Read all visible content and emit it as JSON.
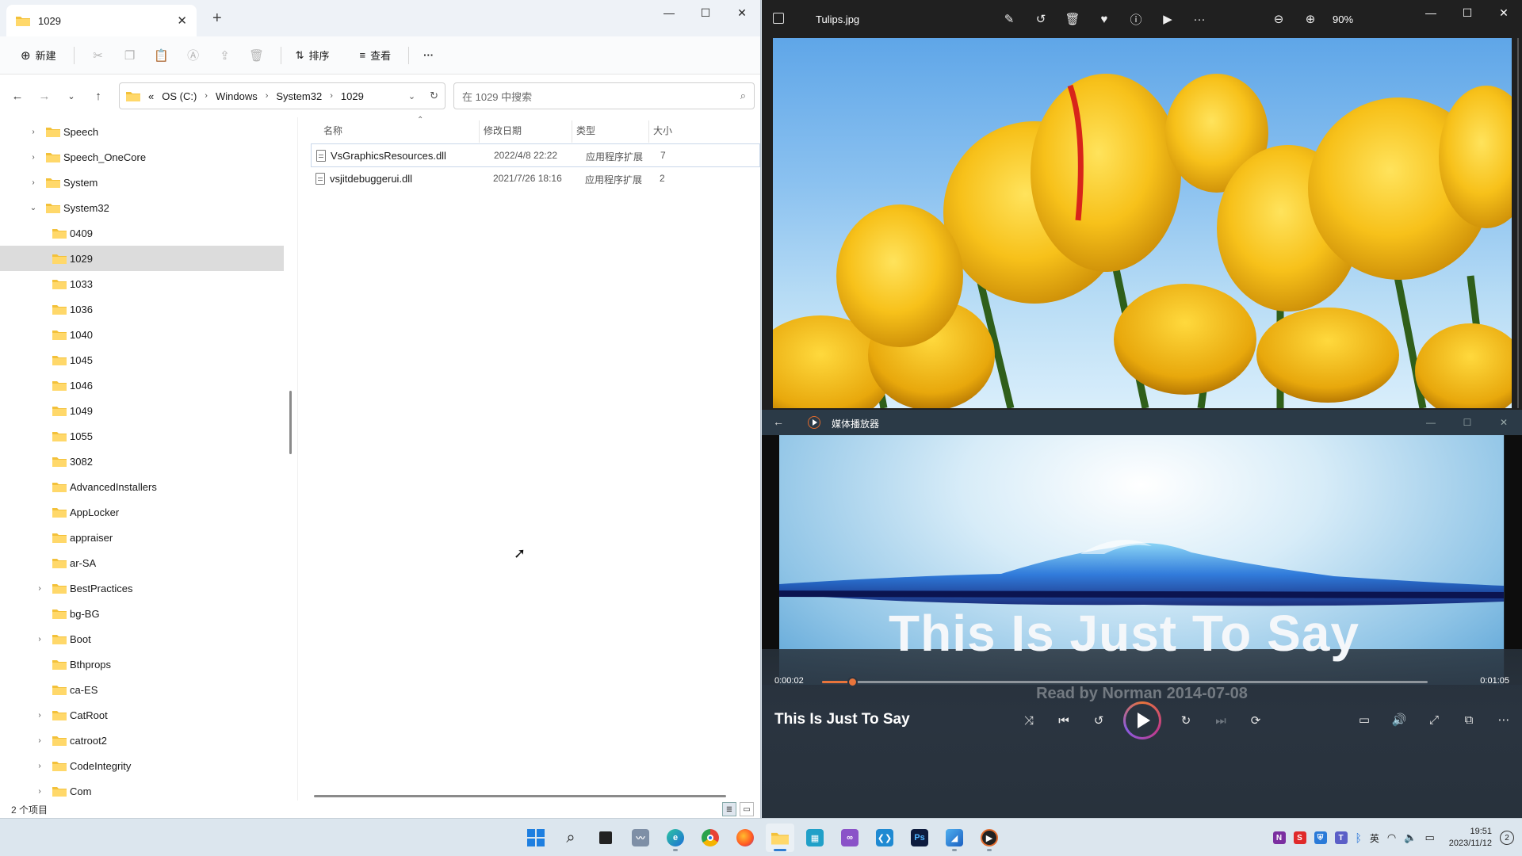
{
  "explorer": {
    "tab_title": "1029",
    "toolbar": {
      "new_label": "新建",
      "sort_label": "排序",
      "view_label": "查看",
      "more_label": "···"
    },
    "address": {
      "overflow": "«",
      "crumbs": [
        "OS (C:)",
        "Windows",
        "System32",
        "1029"
      ]
    },
    "search_placeholder": "在 1029 中搜索",
    "tree": [
      {
        "label": "Speech",
        "level": 0,
        "expand": "collapsed"
      },
      {
        "label": "Speech_OneCore",
        "level": 0,
        "expand": "collapsed"
      },
      {
        "label": "System",
        "level": 0,
        "expand": "collapsed"
      },
      {
        "label": "System32",
        "level": 0,
        "expand": "expanded"
      },
      {
        "label": "0409",
        "level": 1,
        "expand": "none"
      },
      {
        "label": "1029",
        "level": 1,
        "expand": "none",
        "selected": true
      },
      {
        "label": "1033",
        "level": 1,
        "expand": "none"
      },
      {
        "label": "1036",
        "level": 1,
        "expand": "none"
      },
      {
        "label": "1040",
        "level": 1,
        "expand": "none"
      },
      {
        "label": "1045",
        "level": 1,
        "expand": "none"
      },
      {
        "label": "1046",
        "level": 1,
        "expand": "none"
      },
      {
        "label": "1049",
        "level": 1,
        "expand": "none"
      },
      {
        "label": "1055",
        "level": 1,
        "expand": "none"
      },
      {
        "label": "3082",
        "level": 1,
        "expand": "none"
      },
      {
        "label": "AdvancedInstallers",
        "level": 1,
        "expand": "none"
      },
      {
        "label": "AppLocker",
        "level": 1,
        "expand": "none"
      },
      {
        "label": "appraiser",
        "level": 1,
        "expand": "none"
      },
      {
        "label": "ar-SA",
        "level": 1,
        "expand": "none"
      },
      {
        "label": "BestPractices",
        "level": 1,
        "expand": "collapsed"
      },
      {
        "label": "bg-BG",
        "level": 1,
        "expand": "none"
      },
      {
        "label": "Boot",
        "level": 1,
        "expand": "collapsed"
      },
      {
        "label": "Bthprops",
        "level": 1,
        "expand": "none"
      },
      {
        "label": "ca-ES",
        "level": 1,
        "expand": "none"
      },
      {
        "label": "CatRoot",
        "level": 1,
        "expand": "collapsed"
      },
      {
        "label": "catroot2",
        "level": 1,
        "expand": "collapsed"
      },
      {
        "label": "CodeIntegrity",
        "level": 1,
        "expand": "collapsed"
      },
      {
        "label": "Com",
        "level": 1,
        "expand": "collapsed"
      }
    ],
    "columns": {
      "name": "名称",
      "date": "修改日期",
      "type": "类型",
      "size": "大小"
    },
    "files": [
      {
        "name": "VsGraphicsResources.dll",
        "date": "2022/4/8 22:22",
        "type": "应用程序扩展",
        "size": "7"
      },
      {
        "name": "vsjitdebuggerui.dll",
        "date": "2021/7/26 18:16",
        "type": "应用程序扩展",
        "size": "2"
      }
    ],
    "status": "2 个项目"
  },
  "photos": {
    "title": "Tulips.jpg",
    "zoom": "90%"
  },
  "media": {
    "app_title": "媒体播放器",
    "video_title": "This Is Just To Say",
    "video_subtitle": "Read by Norman 2014-07-08",
    "now_playing": "This Is Just To Say",
    "elapsed": "0:00:02",
    "duration": "0:01:05",
    "progress": 0.05
  },
  "taskbar": {
    "ime": "英",
    "time": "19:51",
    "date": "2023/11/12",
    "notifications": "2"
  }
}
